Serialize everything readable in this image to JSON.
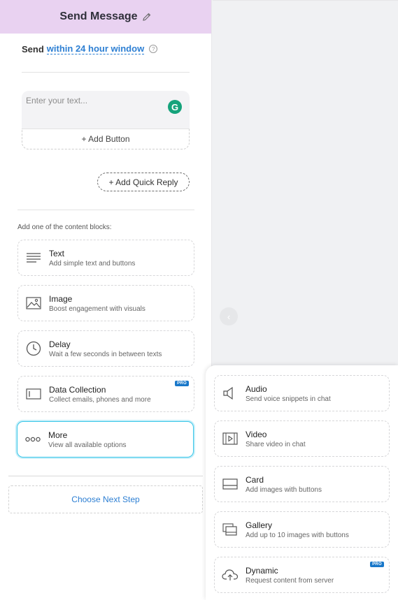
{
  "header": {
    "title": "Send Message",
    "edit_icon": "pencil-icon"
  },
  "send": {
    "label": "Send",
    "link": "within 24 hour window",
    "help": "?"
  },
  "editor": {
    "placeholder": "Enter your text...",
    "grammarly_letter": "G",
    "add_button": "+ Add Button"
  },
  "quick_reply": {
    "label": "+ Add Quick Reply"
  },
  "blocks": {
    "heading": "Add one of the content blocks:",
    "items": [
      {
        "title": "Text",
        "desc": "Add simple text and buttons",
        "icon": "lines-icon"
      },
      {
        "title": "Image",
        "desc": "Boost engagement with visuals",
        "icon": "image-icon"
      },
      {
        "title": "Delay",
        "desc": "Wait a few seconds in between texts",
        "icon": "clock-icon"
      },
      {
        "title": "Data Collection",
        "desc": "Collect emails, phones and more",
        "icon": "form-icon",
        "badge": "PRO"
      },
      {
        "title": "More",
        "desc": "View all available options",
        "icon": "more-icon"
      }
    ]
  },
  "next_step": {
    "label": "Choose Next Step"
  },
  "canvas": {
    "collapse_icon": "chevron-left-icon",
    "collapse_glyph": "‹"
  },
  "more_menu": {
    "items": [
      {
        "title": "Audio",
        "desc": "Send voice snippets in chat",
        "icon": "speaker-icon"
      },
      {
        "title": "Video",
        "desc": "Share video in chat",
        "icon": "video-icon"
      },
      {
        "title": "Card",
        "desc": "Add images with buttons",
        "icon": "card-icon"
      },
      {
        "title": "Gallery",
        "desc": "Add up to 10 images with buttons",
        "icon": "gallery-icon"
      },
      {
        "title": "Dynamic",
        "desc": "Request content from server",
        "icon": "cloud-icon",
        "badge": "PRO"
      }
    ]
  },
  "colors": {
    "header_bg": "#e9d2f1",
    "link": "#2d7fd3",
    "active_border": "#39c6e8",
    "pro_badge": "#1877c9",
    "grammarly": "#15a37b"
  }
}
